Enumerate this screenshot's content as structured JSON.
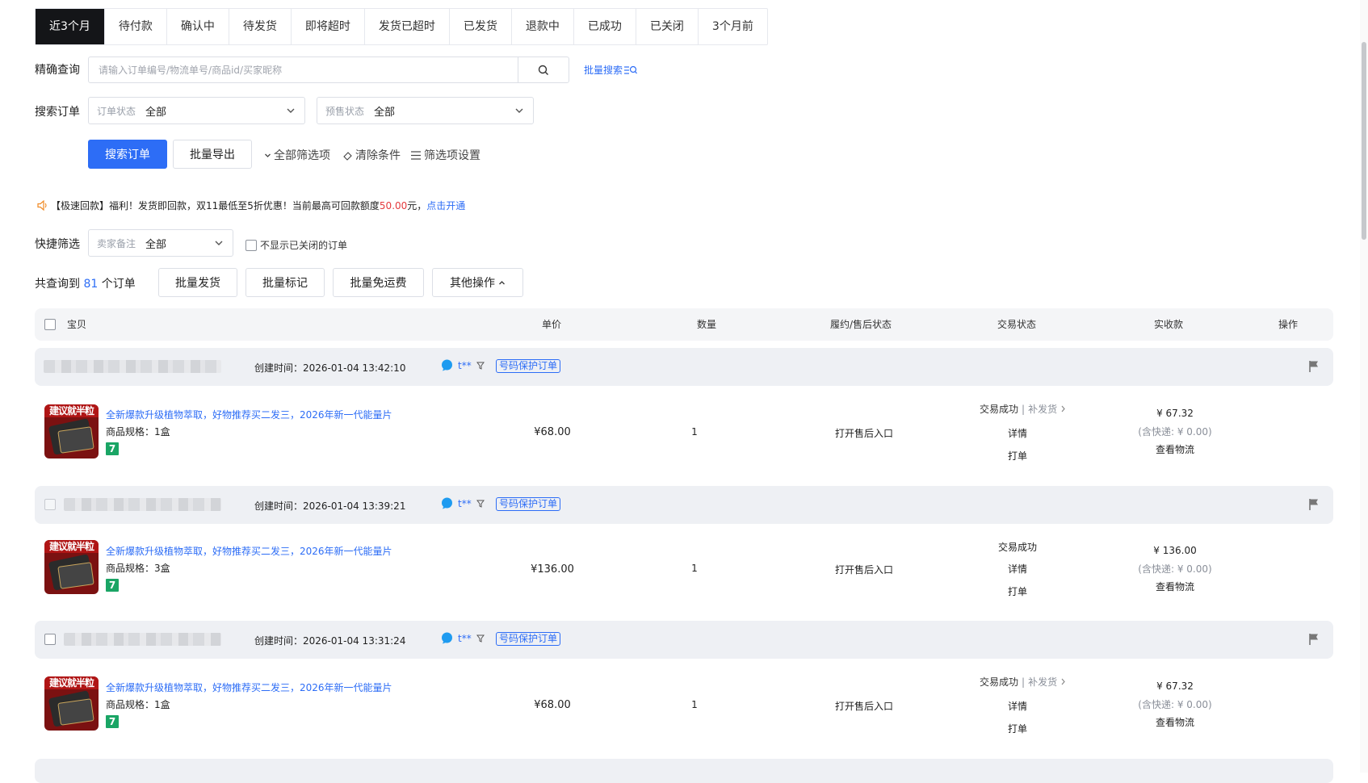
{
  "tabs": [
    "近3个月",
    "待付款",
    "确认中",
    "待发货",
    "即将超时",
    "发货已超时",
    "已发货",
    "退款中",
    "已成功",
    "已关闭",
    "3个月前"
  ],
  "active_tab": 0,
  "search": {
    "label": "精确查询",
    "placeholder": "请输入订单编号/物流单号/商品id/买家昵称",
    "batch_search": "批量搜索",
    "batch_search_icon": "list-search-icon"
  },
  "filter": {
    "label": "搜索订单",
    "order_status_prefix": "订单状态",
    "order_status_value": "全部",
    "presale_status_prefix": "预售状态",
    "presale_status_value": "全部"
  },
  "actions": {
    "search_btn": "搜索订单",
    "export_btn": "批量导出",
    "all_filters": "全部筛选项",
    "clear": "清除条件",
    "filter_settings": "筛选项设置"
  },
  "notice": {
    "icon": "speaker-icon",
    "text_before": "【极速回款】福利！发货即回款，双11最低至5折优惠！当前最高可回款额度",
    "amount": "50.00",
    "text_after": "元，",
    "link": "点击开通"
  },
  "quick": {
    "label": "快捷筛选",
    "remark_prefix": "卖家备注",
    "remark_value": "全部",
    "hide_closed": "不显示已关闭的订单"
  },
  "summary": {
    "prefix": "共查询到",
    "count": "81",
    "suffix": "个订单",
    "batch_ship": "批量发货",
    "batch_mark": "批量标记",
    "batch_free_ship": "批量免运费",
    "other_ops": "其他操作"
  },
  "columns": [
    "宝贝",
    "单价",
    "数量",
    "履约/售后状态",
    "交易状态",
    "实收款",
    "操作"
  ],
  "orders": [
    {
      "created": "创建时间：2026-01-04 13:42:10",
      "buyer": "t**",
      "tag": "号码保护订单",
      "thumb_text": "建议就半粒",
      "title": "全新爆款升级植物萃取，好物推荐买二发三，2026年新一代能量片",
      "spec": "商品规格：1盒",
      "badge": "7",
      "price": "¥68.00",
      "qty": "1",
      "after_sale": "打开售后入口",
      "status": "交易成功",
      "status_extra": "补发货",
      "detail": "详情",
      "print": "打单",
      "received": "¥ 67.32",
      "shipping_note": "(含快递: ¥ 0.00)",
      "logistics": "查看物流"
    },
    {
      "created": "创建时间：2026-01-04 13:39:21",
      "buyer": "t**",
      "tag": "号码保护订单",
      "thumb_text": "建议就半粒",
      "title": "全新爆款升级植物萃取，好物推荐买二发三，2026年新一代能量片",
      "spec": "商品规格：3盒",
      "badge": "7",
      "price": "¥136.00",
      "qty": "1",
      "after_sale": "打开售后入口",
      "status": "交易成功",
      "status_extra": "",
      "detail": "详情",
      "print": "打单",
      "received": "¥ 136.00",
      "shipping_note": "(含快递: ¥ 0.00)",
      "logistics": "查看物流"
    },
    {
      "created": "创建时间：2026-01-04 13:31:24",
      "buyer": "t**",
      "tag": "号码保护订单",
      "thumb_text": "建议就半粒",
      "title": "全新爆款升级植物萃取，好物推荐买二发三，2026年新一代能量片",
      "spec": "商品规格：1盒",
      "badge": "7",
      "price": "¥68.00",
      "qty": "1",
      "after_sale": "打开售后入口",
      "status": "交易成功",
      "status_extra": "补发货",
      "detail": "详情",
      "print": "打单",
      "received": "¥ 67.32",
      "shipping_note": "(含快递: ¥ 0.00)",
      "logistics": "查看物流"
    }
  ],
  "colors": {
    "accent": "#2d6df6",
    "price_red": "#e4393c",
    "active_tab_bg": "#141518",
    "seven_badge": "#1aa565"
  }
}
